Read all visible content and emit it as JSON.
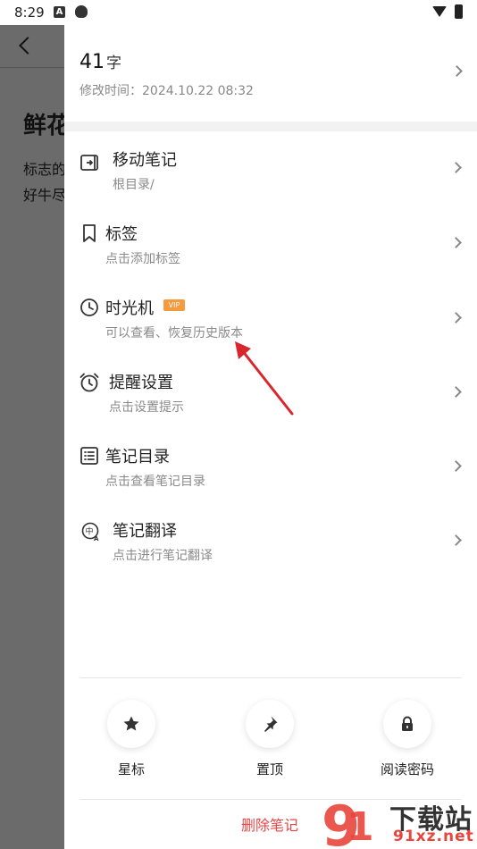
{
  "status_bar": {
    "time": "8:29"
  },
  "background_note": {
    "title": "鲜花",
    "line1": "标志的",
    "line2": "好牛尽"
  },
  "panel": {
    "word_count": "41",
    "word_unit": "字",
    "modified": "修改时间：2024.10.22 08:32",
    "menu": [
      {
        "label": "移动笔记",
        "sub": "根目录/",
        "icon": "move-note-icon"
      },
      {
        "label": "标签",
        "sub": "点击添加标签",
        "icon": "bookmark-icon"
      },
      {
        "label": "时光机",
        "sub": "可以查看、恢复历史版本",
        "icon": "clock-icon",
        "badge": "VIP"
      },
      {
        "label": "提醒设置",
        "sub": "点击设置提示",
        "icon": "alarm-icon"
      },
      {
        "label": "笔记目录",
        "sub": "点击查看笔记目录",
        "icon": "list-icon"
      },
      {
        "label": "笔记翻译",
        "sub": "点击进行笔记翻译",
        "icon": "translate-icon"
      }
    ],
    "actions": [
      {
        "label": "星标",
        "icon": "star-icon"
      },
      {
        "label": "置顶",
        "icon": "pin-icon"
      },
      {
        "label": "阅读密码",
        "icon": "lock-icon"
      }
    ],
    "delete_label": "删除笔记"
  },
  "watermark": {
    "text": "下载站",
    "site": "91xz.net"
  },
  "colors": {
    "accent_red": "#e84545",
    "vip_orange": "#f59a3d",
    "annotation_red": "#d8262c"
  }
}
